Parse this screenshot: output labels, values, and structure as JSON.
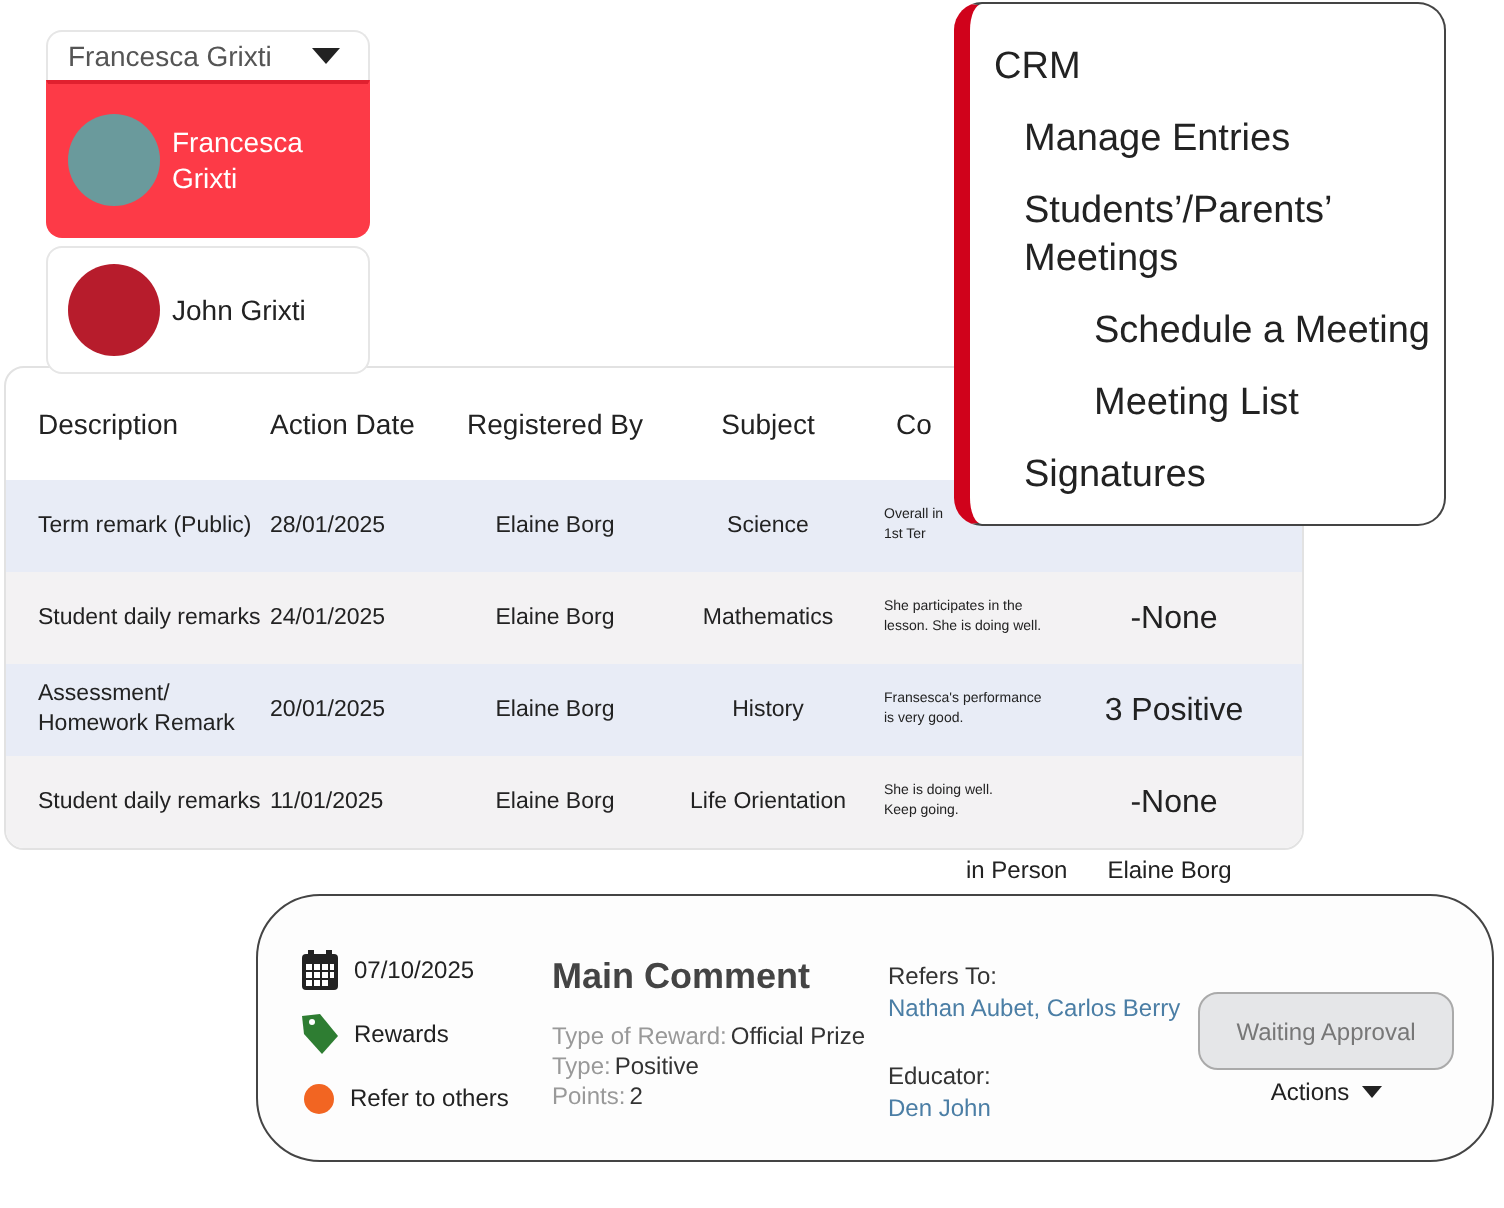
{
  "student_selector": {
    "value": "Francesca Grixti",
    "options": [
      {
        "name": "Francesca Grixti",
        "selected": true
      },
      {
        "name": "John Grixti",
        "selected": false
      }
    ]
  },
  "table": {
    "columns": [
      "Description",
      "Action Date",
      "Registered By",
      "Subject",
      "Co"
    ],
    "rows": [
      {
        "description": "Term remark (Public)",
        "action_date": "28/01/2025",
        "registered_by": "Elaine Borg",
        "subject": "Science",
        "comment": "Overall in\n1st Ter"
      },
      {
        "description": "Student daily remarks",
        "action_date": "24/01/2025",
        "registered_by": "Elaine Borg",
        "subject": "Mathematics",
        "comment": "She participates in the\nlesson. She is doing well.",
        "column_6": "-None"
      },
      {
        "description": "Assessment/\nHomework Remark",
        "action_date": "20/01/2025",
        "registered_by": "Elaine Borg",
        "subject": "History",
        "comment": "Fransesca's performance\nis very good.",
        "column_6": "3 Positive"
      },
      {
        "description": "Student daily remarks",
        "action_date": "11/01/2025",
        "registered_by": "Elaine Borg",
        "subject": "Life Orientation",
        "comment": "She is doing well.\nKeep going.",
        "column_6": "-None"
      }
    ],
    "trailing_row": [
      "in Person",
      "Elaine Borg"
    ]
  },
  "crm_menu": {
    "title": "CRM",
    "children": [
      {
        "label": "Manage Entries"
      },
      {
        "label": "Students’/Parents’\nMeetings",
        "children": [
          {
            "label": "Schedule a Meeting"
          },
          {
            "label": "Meeting List"
          }
        ]
      },
      {
        "label": "Signatures"
      }
    ]
  },
  "entry": {
    "date": "07/10/2025",
    "category": "Rewards",
    "refer": "Refer to others",
    "title": "Main Comment",
    "fields": [
      {
        "label": "Type of Reward:",
        "value": "Official Prize"
      },
      {
        "label": "Type:",
        "value": "Positive"
      },
      {
        "label": "Points:",
        "value": "2"
      }
    ],
    "refers_to": {
      "label": "Refers To:",
      "value": "Nathan Aubet, Carlos Berry"
    },
    "educator": {
      "label": "Educator:",
      "value": "Den John"
    },
    "status_button": "Waiting Approval",
    "actions": "Actions"
  }
}
